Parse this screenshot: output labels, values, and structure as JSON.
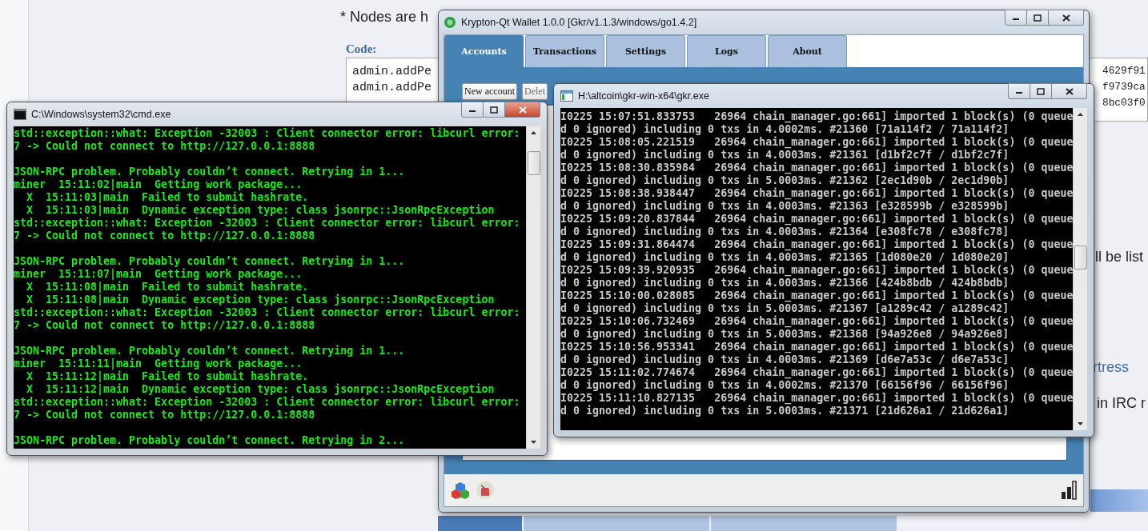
{
  "page": {
    "heading": "* Nodes are h",
    "code_label": "Code:",
    "code_left": [
      "admin.addPe",
      "admin.addPe"
    ],
    "code_right": [
      "4629f91",
      "f9739ca",
      "8bc03f0"
    ],
    "fragments": [
      {
        "kind": "text",
        "text": "ll be list"
      },
      {
        "kind": "link",
        "text": "rtress"
      },
      {
        "kind": "text",
        "text": "in IRC r"
      }
    ]
  },
  "wallet": {
    "title": "Krypton-Qt Wallet 1.0.0 [Gkr/v1.1.3/windows/go1.4.2]",
    "tabs": [
      {
        "label": "Accounts",
        "selected": true
      },
      {
        "label": "Transactions",
        "selected": false
      },
      {
        "label": "Settings",
        "selected": false
      },
      {
        "label": "Logs",
        "selected": false
      },
      {
        "label": "About",
        "selected": false
      }
    ],
    "buttons": [
      "New account",
      "Delet"
    ]
  },
  "cmd": {
    "title": "C:\\Windows\\system32\\cmd.exe",
    "blocks": [
      [
        "std::exception::what: Exception -32003 : Client connector error: libcurl error:",
        "7 -> Could not connect to http://127.0.0.1:8888"
      ],
      [
        "JSON-RPC problem. Probably couldn’t connect. Retrying in 1...",
        "miner  15:11:02|main  Getting work package...",
        "  X  15:11:03|main  Failed to submit hashrate.",
        "  X  15:11:03|main  Dynamic exception type: class jsonrpc::JsonRpcException",
        "std::exception::what: Exception -32003 : Client connector error: libcurl error:",
        "7 -> Could not connect to http://127.0.0.1:8888"
      ],
      [
        "JSON-RPC problem. Probably couldn’t connect. Retrying in 1...",
        "miner  15:11:07|main  Getting work package...",
        "  X  15:11:08|main  Failed to submit hashrate.",
        "  X  15:11:08|main  Dynamic exception type: class jsonrpc::JsonRpcException",
        "std::exception::what: Exception -32003 : Client connector error: libcurl error:",
        "7 -> Could not connect to http://127.0.0.1:8888"
      ],
      [
        "JSON-RPC problem. Probably couldn’t connect. Retrying in 1...",
        "miner  15:11:11|main  Getting work package...",
        "  X  15:11:12|main  Failed to submit hashrate.",
        "  X  15:11:12|main  Dynamic exception type: class jsonrpc::JsonRpcException",
        "std::exception::what: Exception -32003 : Client connector error: libcurl error:",
        "7 -> Could not connect to http://127.0.0.1:8888"
      ],
      [
        "JSON-RPC problem. Probably couldn’t connect. Retrying in 2..."
      ]
    ]
  },
  "gkr": {
    "title": "H:\\altcoin\\gkr-win-x64\\gkr.exe",
    "lines": [
      "I0225 15:07:51.833753   26964 chain_manager.go:661] imported 1 block(s) (0 queue",
      "d 0 ignored) including 0 txs in 4.0002ms. #21360 [71a114f2 / 71a114f2]",
      "I0225 15:08:05.221519   26964 chain_manager.go:661] imported 1 block(s) (0 queue",
      "d 0 ignored) including 0 txs in 4.0003ms. #21361 [d1bf2c7f / d1bf2c7f]",
      "I0225 15:08:30.835984   26964 chain_manager.go:661] imported 1 block(s) (0 queue",
      "d 0 ignored) including 0 txs in 5.0003ms. #21362 [2ec1d90b / 2ec1d90b]",
      "I0225 15:08:38.938447   26964 chain_manager.go:661] imported 1 block(s) (0 queue",
      "d 0 ignored) including 0 txs in 4.0003ms. #21363 [e328599b / e328599b]",
      "I0225 15:09:20.837844   26964 chain_manager.go:661] imported 1 block(s) (0 queue",
      "d 0 ignored) including 0 txs in 4.0003ms. #21364 [e308fc78 / e308fc78]",
      "I0225 15:09:31.864474   26964 chain_manager.go:661] imported 1 block(s) (0 queue",
      "d 0 ignored) including 0 txs in 4.0003ms. #21365 [1d080e20 / 1d080e20]",
      "I0225 15:09:39.920935   26964 chain_manager.go:661] imported 1 block(s) (0 queue",
      "d 0 ignored) including 0 txs in 4.0003ms. #21366 [424b8bdb / 424b8bdb]",
      "I0225 15:10:00.028085   26964 chain_manager.go:661] imported 1 block(s) (0 queue",
      "d 0 ignored) including 0 txs in 5.0003ms. #21367 [a1289c42 / a1289c42]",
      "I0225 15:10:06.732469   26964 chain_manager.go:661] imported 1 block(s) (0 queue",
      "d 0 ignored) including 0 txs in 5.0003ms. #21368 [94a926e8 / 94a926e8]",
      "I0225 15:10:56.953341   26964 chain_manager.go:661] imported 1 block(s) (0 queue",
      "d 0 ignored) including 0 txs in 4.0003ms. #21369 [d6e7a53c / d6e7a53c]",
      "I0225 15:11:02.774674   26964 chain_manager.go:661] imported 1 block(s) (0 queue",
      "d 0 ignored) including 0 txs in 4.0002ms. #21370 [66156f96 / 66156f96]",
      "I0225 15:11:10.827135   26964 chain_manager.go:661] imported 1 block(s) (0 queue",
      "d 0 ignored) including 0 txs in 5.0003ms. #21371 [21d626a1 / 21d626a1]"
    ]
  }
}
